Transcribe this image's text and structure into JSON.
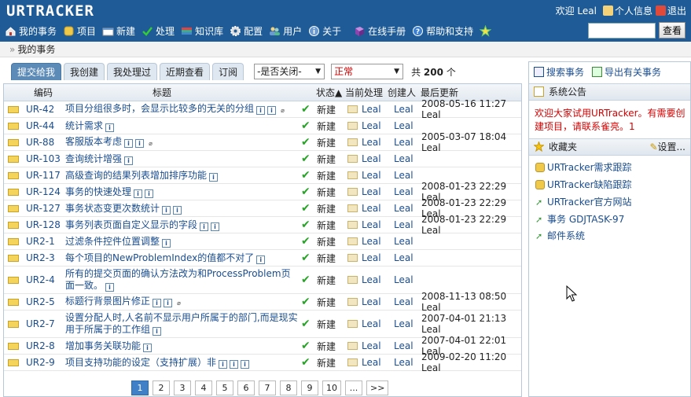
{
  "app": {
    "logo": "URTRACKER"
  },
  "top_links": {
    "welcome": "欢迎 Leal",
    "personal_info": "个人信息",
    "logout": "退出"
  },
  "nav": [
    {
      "label": "我的事务",
      "icon": "home-icon"
    },
    {
      "label": "项目",
      "icon": "database-icon"
    },
    {
      "label": "新建",
      "icon": "new-icon"
    },
    {
      "label": "处理",
      "icon": "check-icon"
    },
    {
      "label": "知识库",
      "icon": "books-icon"
    },
    {
      "label": "配置",
      "icon": "gear-icon"
    },
    {
      "label": "用户",
      "icon": "users-icon"
    },
    {
      "label": "关于",
      "icon": "info-icon"
    },
    {
      "label": "在线手册",
      "icon": "manual-icon"
    },
    {
      "label": "帮助和支持",
      "icon": "help-icon"
    },
    {
      "label": "",
      "icon": "star-icon"
    }
  ],
  "search": {
    "value": "",
    "button": "查看"
  },
  "breadcrumb": {
    "sep": "»",
    "text": "我的事务"
  },
  "tabs": [
    {
      "label": "提交给我",
      "active": true
    },
    {
      "label": "我创建"
    },
    {
      "label": "我处理过"
    },
    {
      "label": "近期查看"
    },
    {
      "label": "订阅"
    }
  ],
  "filters": {
    "closed": "-是否关闭-",
    "status": "正常",
    "total_prefix": "共",
    "total_count": "200",
    "total_suffix": "个"
  },
  "columns": {
    "code": "编码",
    "title": "标题",
    "status": "状态▲",
    "assignee": "当前处理",
    "creator": "创建人",
    "updated": "最后更新"
  },
  "rows": [
    {
      "code": "UR-42",
      "title": "项目分组很多时，会显示比较多的无关的分组",
      "icons": "ii+",
      "status": "新建",
      "assignee": "Leal",
      "creator": "Leal",
      "updated": "2008-05-16 11:27 Leal"
    },
    {
      "code": "UR-44",
      "title": "统计需求",
      "icons": "i",
      "status": "新建",
      "assignee": "Leal",
      "creator": "Leal",
      "updated": ""
    },
    {
      "code": "UR-88",
      "title": "客服版本考虑",
      "icons": "ii+",
      "status": "新建",
      "assignee": "Leal",
      "creator": "Leal",
      "updated": "2005-03-07 18:04 Leal"
    },
    {
      "code": "UR-103",
      "title": "查询统计增强",
      "icons": "i",
      "status": "新建",
      "assignee": "Leal",
      "creator": "Leal",
      "updated": ""
    },
    {
      "code": "UR-117",
      "title": "高级查询的结果列表增加排序功能",
      "icons": "i",
      "status": "新建",
      "assignee": "Leal",
      "creator": "Leal",
      "updated": ""
    },
    {
      "code": "UR-124",
      "title": "事务的快速处理",
      "icons": "ii",
      "status": "新建",
      "assignee": "Leal",
      "creator": "Leal",
      "updated": "2008-01-23 22:29 Leal"
    },
    {
      "code": "UR-127",
      "title": "事务状态变更次数统计",
      "icons": "ii",
      "status": "新建",
      "assignee": "Leal",
      "creator": "Leal",
      "updated": "2008-01-23 22:29 Leal"
    },
    {
      "code": "UR-128",
      "title": "事务列表页面自定义显示的字段",
      "icons": "ii",
      "status": "新建",
      "assignee": "Leal",
      "creator": "Leal",
      "updated": "2008-01-23 22:29 Leal"
    },
    {
      "code": "UR2-1",
      "title": "过滤条件控件位置调整",
      "icons": "i",
      "status": "新建",
      "assignee": "Leal",
      "creator": "Leal",
      "updated": ""
    },
    {
      "code": "UR2-3",
      "title": "每个项目的NewProblemIndex的值都不对了",
      "icons": "i",
      "status": "新建",
      "assignee": "Leal",
      "creator": "Leal",
      "updated": ""
    },
    {
      "code": "UR2-4",
      "title": "所有的提交页面的确认方法改为和ProcessProblem页面一致。",
      "icons": "i",
      "status": "新建",
      "assignee": "Leal",
      "creator": "Leal",
      "updated": ""
    },
    {
      "code": "UR2-5",
      "title": "标题行背景图片修正",
      "icons": "ii+",
      "status": "新建",
      "assignee": "Leal",
      "creator": "Leal",
      "updated": "2008-11-13 08:50 Leal"
    },
    {
      "code": "UR2-7",
      "title": "设置分配人时,人名前不显示用户所属于的部门,而是现实用于所属于的工作组",
      "icons": "i",
      "status": "新建",
      "assignee": "Leal",
      "creator": "Leal",
      "updated": "2007-04-01 21:13 Leal"
    },
    {
      "code": "UR2-8",
      "title": "增加事务关联功能",
      "icons": "i",
      "status": "新建",
      "assignee": "Leal",
      "creator": "Leal",
      "updated": "2007-04-01 22:01 Leal"
    },
    {
      "code": "UR2-9",
      "title": "项目支持功能的设定（支持扩展）非",
      "icons": "iii",
      "status": "新建",
      "assignee": "Leal",
      "creator": "Leal",
      "updated": "2009-02-20 11:20 Leal"
    }
  ],
  "pager": [
    "1",
    "2",
    "3",
    "4",
    "5",
    "6",
    "7",
    "8",
    "9",
    "10",
    "...",
    ">>"
  ],
  "sidebar": {
    "search_link": "搜索事务",
    "export_link": "导出有关事务",
    "announce_title": "系统公告",
    "announce_text": "欢迎大家试用URTracker。有需要创建项目，请联系雀亮。1",
    "fav_title": "收藏夹",
    "fav_settings": "设置...",
    "favorites": [
      {
        "label": "URTracker需求跟踪",
        "icon": "database-icon"
      },
      {
        "label": "URTracker缺陷跟踪",
        "icon": "database-icon"
      },
      {
        "label": "URTracker官方网站",
        "icon": "link-arrow-icon"
      },
      {
        "label": "事务 GDJTASK-97",
        "icon": "link-arrow-icon"
      },
      {
        "label": "邮件系统",
        "icon": "link-arrow-icon"
      }
    ]
  },
  "colors": {
    "topbar": "#1f5b96",
    "link": "#1a4d8f",
    "announce": "#d40000",
    "active_page": "#3f80c7"
  }
}
